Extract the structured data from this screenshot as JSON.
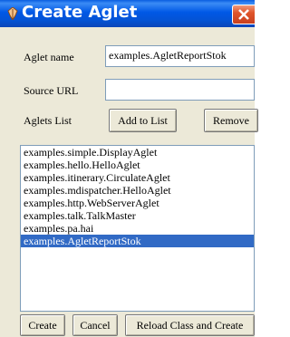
{
  "window": {
    "title": "Create Aglet"
  },
  "form": {
    "aglet_name_label": "Aglet name",
    "aglet_name_value": "examples.AgletReportStok",
    "source_url_label": "Source URL",
    "source_url_value": "",
    "aglets_list_label": "Aglets List",
    "add_to_list_label": "Add to List",
    "remove_label": "Remove"
  },
  "list": {
    "items": [
      "examples.simple.DisplayAglet",
      "examples.hello.HelloAglet",
      "examples.itinerary.CirculateAglet",
      "examples.mdispatcher.HelloAglet",
      "examples.http.WebServerAglet",
      "examples.talk.TalkMaster",
      "examples.pa.hai",
      "examples.AgletReportStok"
    ],
    "selected_index": 7
  },
  "buttons": {
    "create_label": "Create",
    "cancel_label": "Cancel",
    "reload_label": "Reload Class and Create"
  },
  "colors": {
    "titlebar": "#0058e6",
    "selection": "#316ac5",
    "window_bg": "#ece9d8",
    "close_button": "#e0552b"
  },
  "icons": {
    "title": "aglet-feather-icon",
    "close": "close-icon"
  }
}
